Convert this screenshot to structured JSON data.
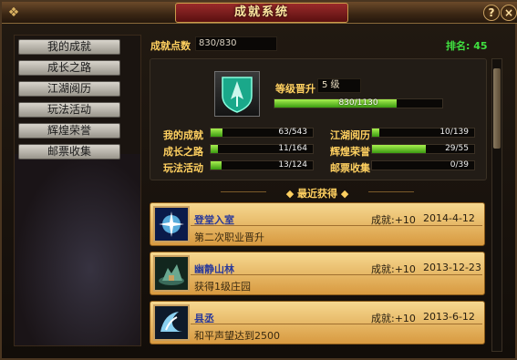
{
  "window": {
    "title": "成就系统",
    "help_label": "?",
    "close_label": "×"
  },
  "menu": {
    "items": [
      {
        "label": "我的成就"
      },
      {
        "label": "成长之路"
      },
      {
        "label": "江湖阅历"
      },
      {
        "label": "玩法活动"
      },
      {
        "label": "辉煌荣誉"
      },
      {
        "label": "邮票收集"
      }
    ]
  },
  "summary": {
    "points_label": "成就点数",
    "points_value": "830/830",
    "rank_text": "排名: 45",
    "level_label": "等级晋升",
    "level_value": "5 级",
    "exp_text": "830/1130",
    "exp_fraction": 0.73
  },
  "stats": [
    {
      "label": "我的成就",
      "value": "63/543",
      "fraction": 0.116
    },
    {
      "label": "江湖阅历",
      "value": "10/139",
      "fraction": 0.072
    },
    {
      "label": "成长之路",
      "value": "11/164",
      "fraction": 0.067
    },
    {
      "label": "辉煌荣誉",
      "value": "29/55",
      "fraction": 0.527
    },
    {
      "label": "玩法活动",
      "value": "13/124",
      "fraction": 0.105
    },
    {
      "label": "邮票收集",
      "value": "0/39",
      "fraction": 0.0
    }
  ],
  "recent": {
    "header": "最近获得",
    "entries": [
      {
        "name": "登堂入室",
        "desc": "第二次职业晋升",
        "points": "成就:+10",
        "date": "2014-4-12"
      },
      {
        "name": "幽静山林",
        "desc": "获得1级庄园",
        "points": "成就:+10",
        "date": "2013-12-23"
      },
      {
        "name": "县丞",
        "desc": "和平声望达到2500",
        "points": "成就:+10",
        "date": "2013-6-12"
      }
    ]
  },
  "colors": {
    "accent": "#ffd060",
    "bar_green": "#7ad030",
    "rank_green": "#40e040",
    "title_red": "#8a2020"
  },
  "icons": [
    "help-icon",
    "close-icon",
    "emblem-icon",
    "achievement-icon-1",
    "achievement-icon-2",
    "achievement-icon-3"
  ]
}
